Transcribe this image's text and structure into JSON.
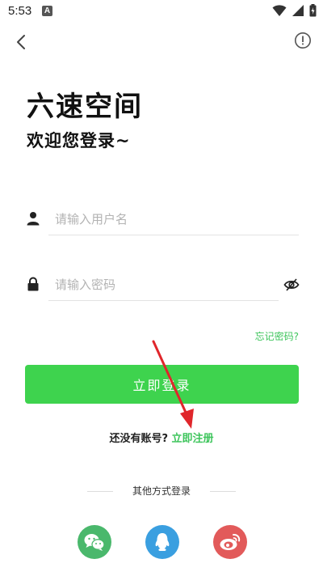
{
  "status_bar": {
    "time": "5:53",
    "notification_badge": "A"
  },
  "header": {
    "back_icon": "chevron-left-icon",
    "info_icon": "info-circle-icon"
  },
  "hero": {
    "title": "六速空间",
    "subtitle": "欢迎您登录~"
  },
  "form": {
    "username_placeholder": "请输入用户名",
    "password_placeholder": "请输入密码",
    "forgot_password": "忘记密码?",
    "login_button": "立即登录"
  },
  "register": {
    "question": "还没有账号?",
    "link": "立即注册"
  },
  "alt_login": {
    "label": "其他方式登录",
    "providers": [
      "wechat-icon",
      "qq-icon",
      "weibo-icon"
    ]
  },
  "colors": {
    "accent": "#3ed34e",
    "link": "#3ec55c",
    "annotation_arrow": "#e0262b"
  }
}
